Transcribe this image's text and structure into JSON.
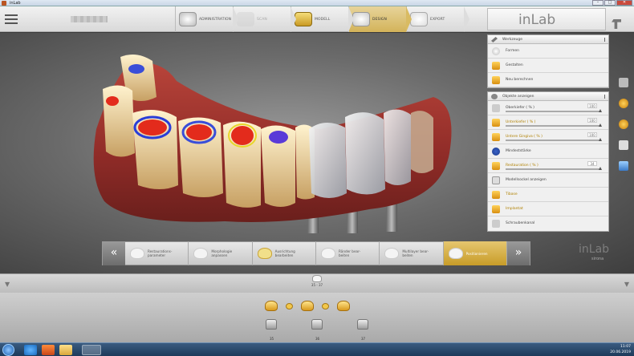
{
  "window": {
    "title": "inLab",
    "controls": [
      "minimize",
      "maximize",
      "close"
    ]
  },
  "header": {
    "steps": [
      {
        "label": "ADMINISTRATION",
        "icon": "jaw-icon",
        "state": "normal"
      },
      {
        "label": "SCAN",
        "icon": "scan-icon",
        "state": "disabled"
      },
      {
        "label": "MODELL",
        "icon": "model-icon",
        "state": "normal"
      },
      {
        "label": "DESIGN",
        "icon": "design-icon",
        "state": "active"
      },
      {
        "label": "EXPORT",
        "icon": "export-icon",
        "state": "normal"
      }
    ],
    "brand": "inLab"
  },
  "panel": {
    "tools_header": "Werkzeuge",
    "tools": [
      {
        "label": "Formen",
        "icon": "shape-icon"
      },
      {
        "label": "Gestalten",
        "icon": "design-tool-icon"
      },
      {
        "label": "Neu berechnen",
        "icon": "recalculate-icon"
      }
    ],
    "objects_header": "Objekte anzeigen",
    "objects": [
      {
        "label": "Oberkiefer  ( % )",
        "value": "100",
        "highlight": false,
        "slider": 1.0
      },
      {
        "label": "Unterkiefer  ( % )",
        "value": "100",
        "highlight": true,
        "slider": 1.0
      },
      {
        "label": "Untere Gingiva  ( % )",
        "value": "100",
        "highlight": true,
        "slider": 1.0
      },
      {
        "label": "Mindeststärke",
        "value": "",
        "highlight": false
      },
      {
        "label": "Restauration  ( % )",
        "value": "34",
        "highlight": true,
        "slider": 0.34
      },
      {
        "label": "Modellsockel anzeigen",
        "value": "",
        "highlight": false
      },
      {
        "label": "Tibase",
        "value": "",
        "highlight": true
      },
      {
        "label": "Implantat",
        "value": "",
        "highlight": true
      },
      {
        "label": "Schraubenkanal",
        "value": "",
        "highlight": false
      }
    ]
  },
  "workflow": {
    "prev": "«",
    "next": "»",
    "steps": [
      {
        "label": "Restaurations-\nparameter",
        "state": "normal"
      },
      {
        "label": "Morphologie\nanpassen",
        "state": "normal"
      },
      {
        "label": "Ausrichtung\nbearbeiten",
        "state": "done"
      },
      {
        "label": "Ränder bear-\nbeiten",
        "state": "normal"
      },
      {
        "label": "Multilayer bear-\nbeiten",
        "state": "normal"
      },
      {
        "label": "Positionieren",
        "state": "active"
      }
    ],
    "brand": "inLab",
    "sub_brand": "sirona"
  },
  "tooth_tab": {
    "label": "35 - 37"
  },
  "teeth": {
    "numbers": [
      "35",
      "36",
      "37"
    ]
  },
  "taskbar": {
    "time": "11:07",
    "date": "20.06.2019"
  },
  "colors": {
    "accent": "#d3b35a",
    "highlight_text": "#b08000"
  }
}
